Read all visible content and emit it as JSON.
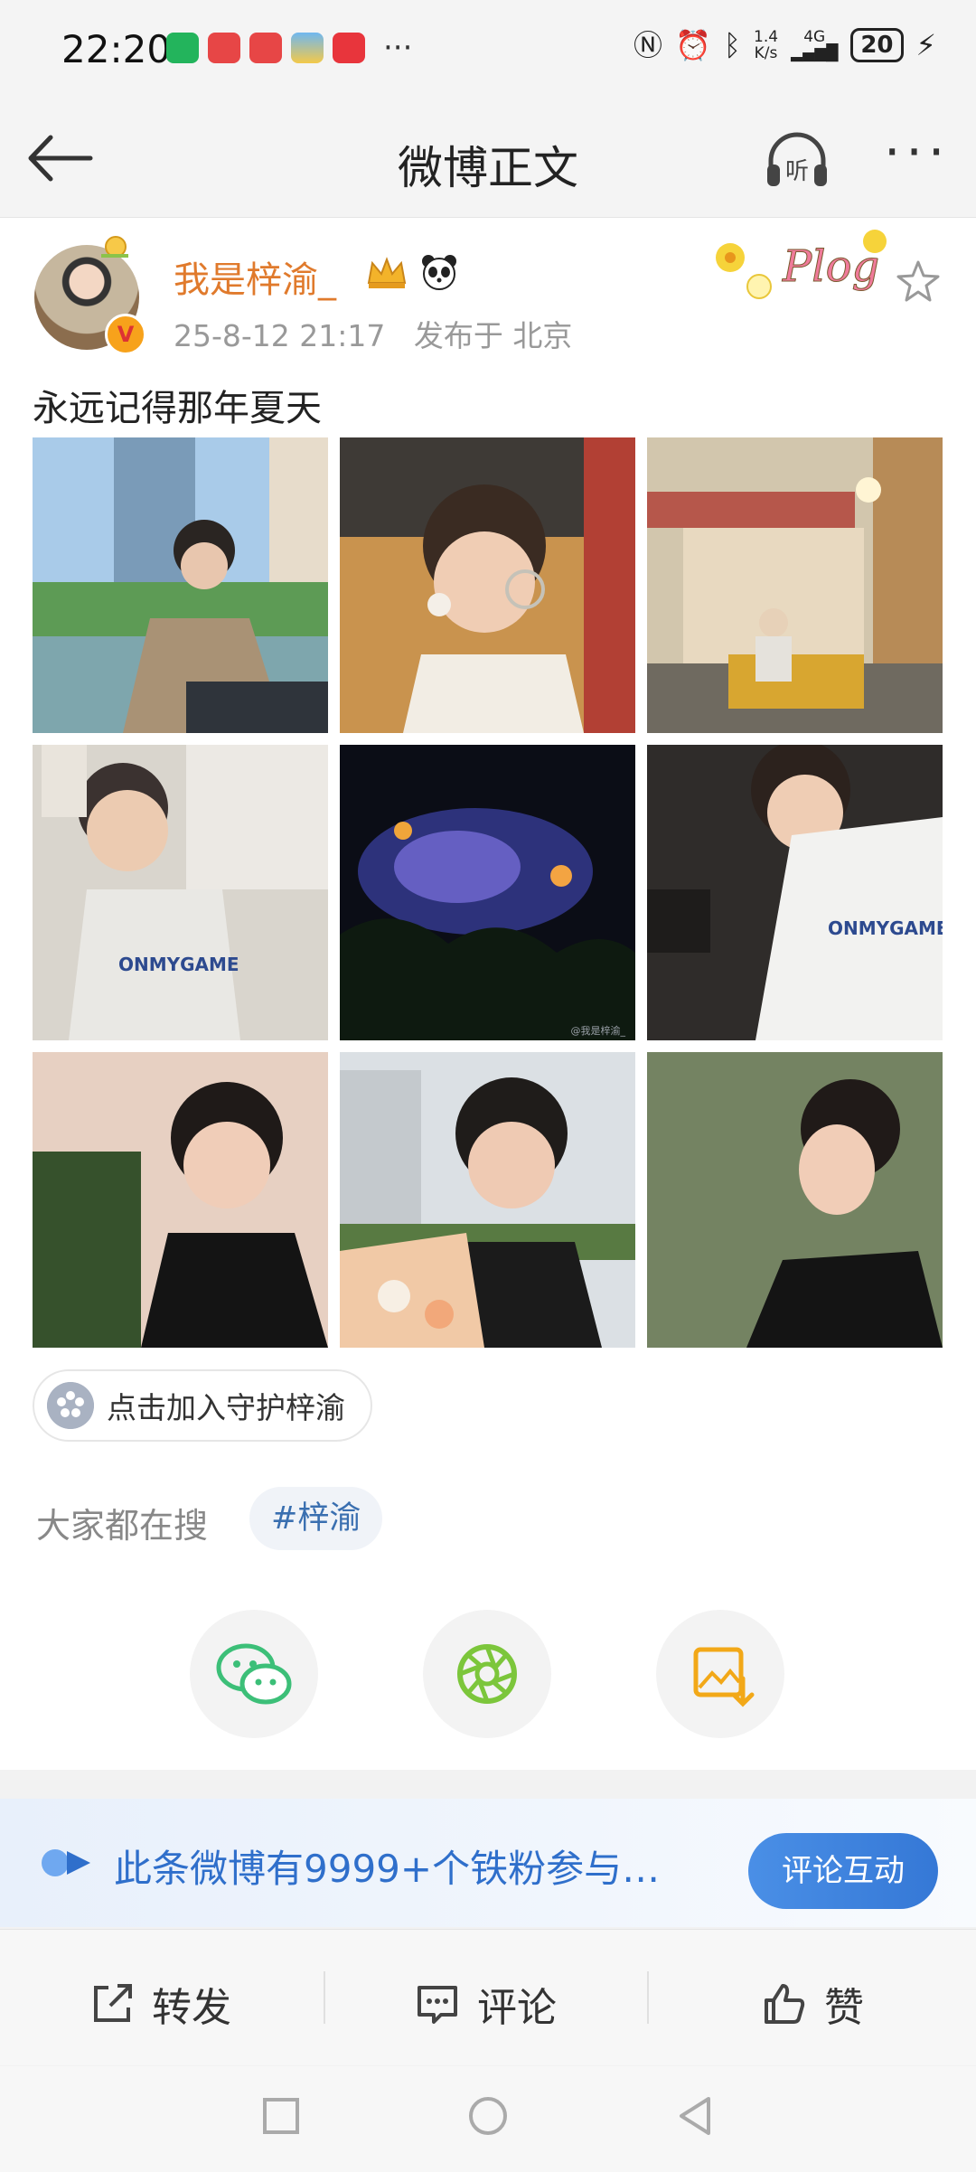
{
  "status_bar": {
    "time": "22:20",
    "network_speed_value": "1.4",
    "network_speed_unit": "K/s",
    "signal": "4G",
    "battery": "20",
    "more": "···"
  },
  "nav": {
    "title": "微博正文",
    "listen_label": "听",
    "more": "···"
  },
  "post": {
    "username": "我是梓渝_",
    "timestamp": "25-8-12 21:17",
    "location": "发布于 北京",
    "sticker_text": "Plog",
    "text": "永远记得那年夏天",
    "photos": [
      {
        "icon": "photo-city-waterfront"
      },
      {
        "icon": "photo-glasses-closeup"
      },
      {
        "icon": "photo-street-tricycle"
      },
      {
        "icon": "photo-boxing-glove",
        "shirt_text": "ONMYGAME"
      },
      {
        "icon": "photo-fireworks",
        "watermark": "@我是梓渝_"
      },
      {
        "icon": "photo-tshirt-reading",
        "shirt_text": "ONMYGAME"
      },
      {
        "icon": "photo-portrait-trees"
      },
      {
        "icon": "photo-bouquet"
      },
      {
        "icon": "photo-looking-up"
      }
    ],
    "join_label": "点击加入守护梓渝"
  },
  "search": {
    "label": "大家都在搜",
    "tag": "#梓渝"
  },
  "share_icons": [
    "wechat-icon",
    "moments-icon",
    "save-image-icon"
  ],
  "banner": {
    "text": "此条微博有9999+个铁粉参与…",
    "button": "评论互动"
  },
  "actions": {
    "repost": "转发",
    "comment": "评论",
    "like": "赞"
  },
  "colors": {
    "username": "#e07a2c",
    "link_blue": "#2f6fcb",
    "wechat_green": "#3cbf78",
    "moments_green": "#7cc63b",
    "save_orange": "#f2a818"
  }
}
